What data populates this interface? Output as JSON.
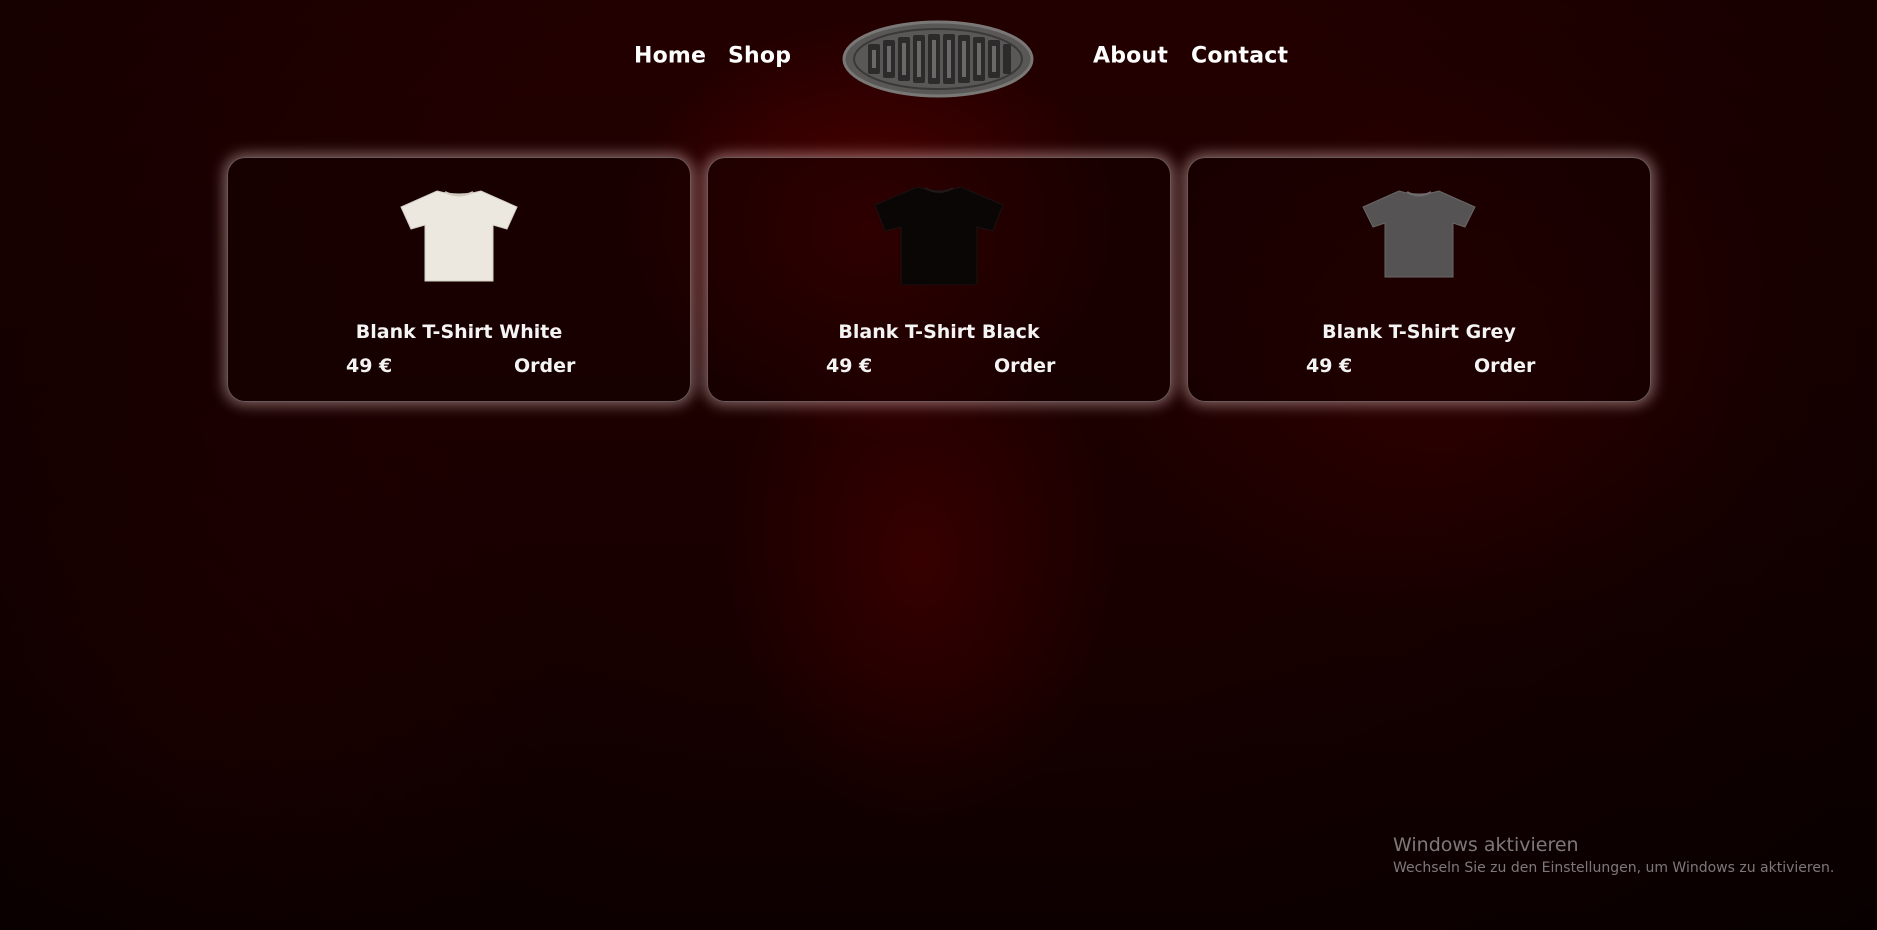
{
  "nav": {
    "links": [
      {
        "label": "Home"
      },
      {
        "label": "Shop"
      },
      {
        "label": "About"
      },
      {
        "label": "Contact"
      }
    ],
    "logo_text": "SHUOUBYVIE"
  },
  "products": [
    {
      "name": "Blank T-Shirt White",
      "price": "49 €",
      "order_label": "Order",
      "shirt_color": "#ece8df"
    },
    {
      "name": "Blank T-Shirt Black",
      "price": "49 €",
      "order_label": "Order",
      "shirt_color": "#0b0606"
    },
    {
      "name": "Blank T-Shirt Grey",
      "price": "49 €",
      "order_label": "Order",
      "shirt_color": "#555353"
    }
  ],
  "watermark": {
    "title": "Windows aktivieren",
    "subtitle": "Wechseln Sie zu den Einstellungen, um Windows zu aktivieren."
  },
  "colors": {
    "background": "#1a0000",
    "card_glow": "#ffdcdc",
    "text": "#f4f4f4"
  }
}
